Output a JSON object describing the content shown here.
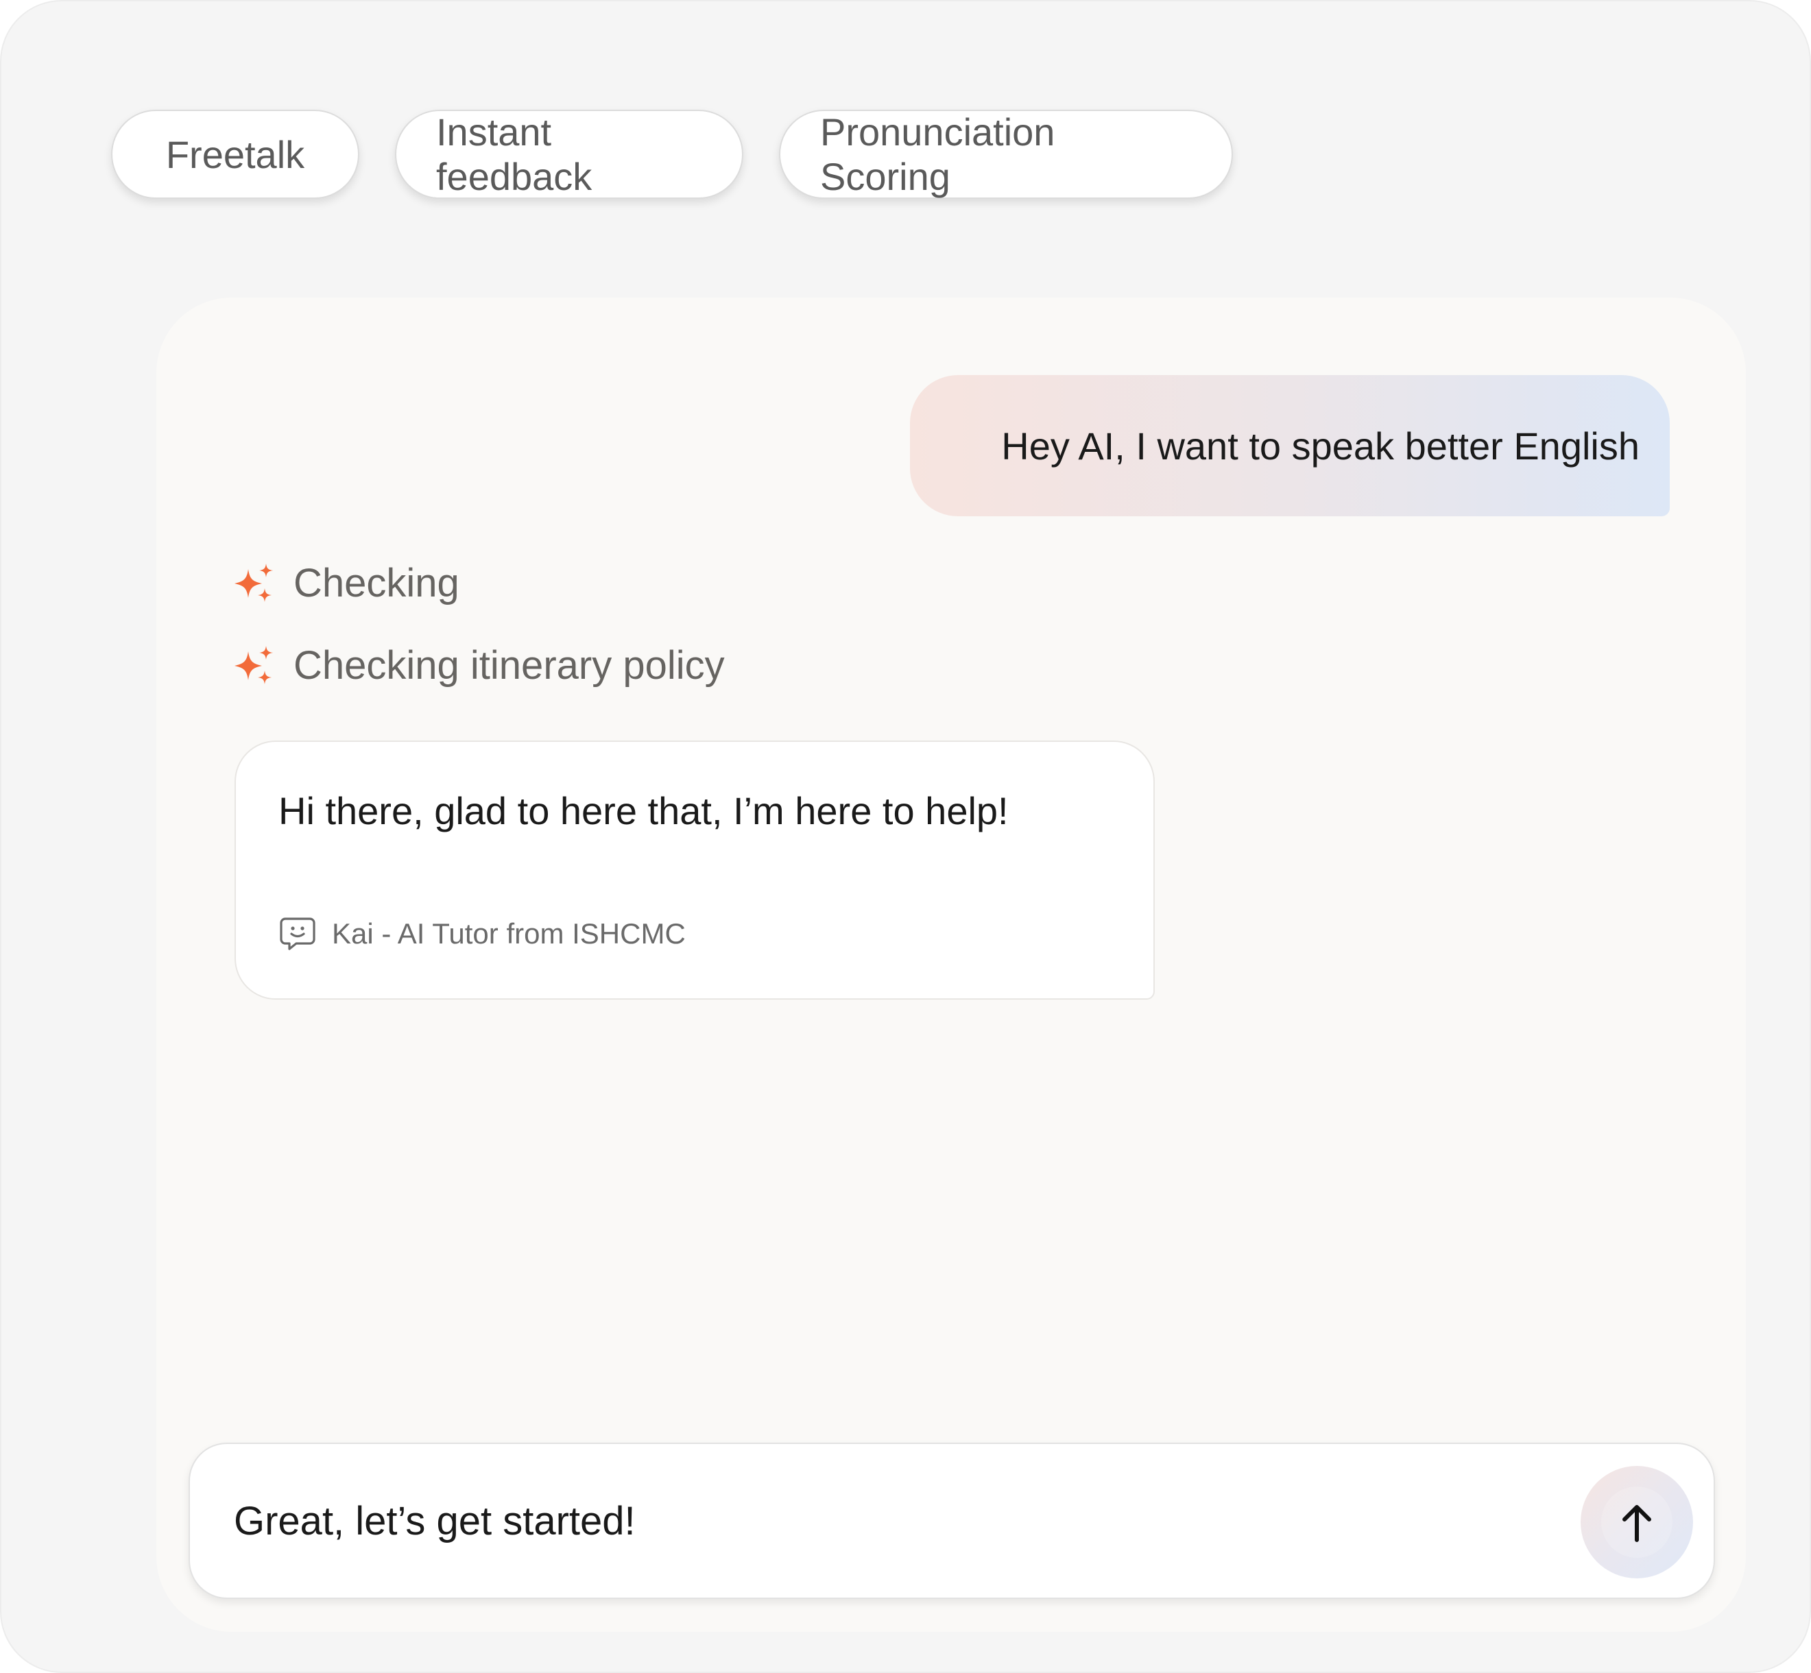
{
  "chips": [
    {
      "label": "Freetalk"
    },
    {
      "label": "Instant feedback"
    },
    {
      "label": "Pronunciation Scoring"
    }
  ],
  "chat": {
    "user_message": "Hey AI, I want to speak better English",
    "statuses": [
      {
        "icon": "sparkle-icon",
        "text": "Checking"
      },
      {
        "icon": "sparkle-icon",
        "text": "Checking itinerary policy"
      }
    ],
    "ai_message": "Hi there, glad to here that, I’m here to help!",
    "ai_sender": "Kai - AI Tutor from ISHCMC",
    "ai_sender_icon": "chat-bot-icon"
  },
  "composer": {
    "value": "Great, let’s get started!",
    "send_icon": "arrow-up-icon"
  },
  "colors": {
    "accent": "#F26B3A",
    "user_bubble_start": "#F7E4DF",
    "user_bubble_end": "#DDE7F6"
  }
}
